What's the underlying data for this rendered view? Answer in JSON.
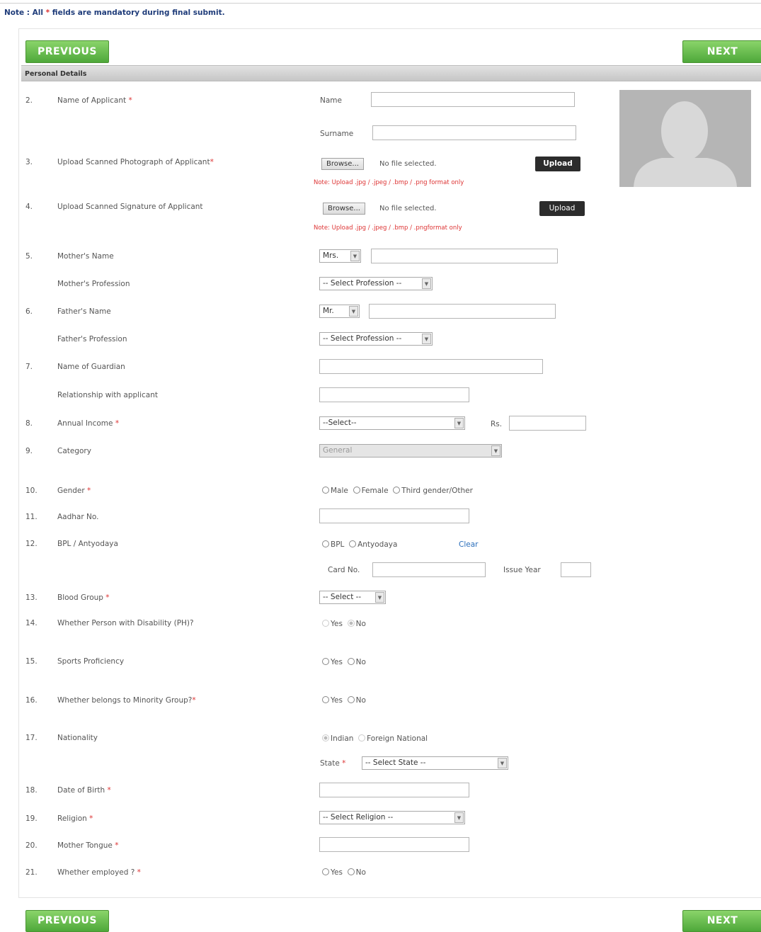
{
  "note": {
    "prefix": "Note : All",
    "star": "*",
    "suffix": "fields are mandatory during final submit."
  },
  "buttons": {
    "previous": "PREVIOUS",
    "next": "NEXT"
  },
  "section_title": "Personal Details",
  "q2": {
    "num": "2.",
    "label": "Name of Applicant",
    "star": "*",
    "name_label": "Name",
    "surname_label": "Surname"
  },
  "q3": {
    "num": "3.",
    "label": "Upload Scanned Photograph of Applicant",
    "star": "*",
    "browse": "Browse...",
    "file_status": "No file selected.",
    "upload": "Upload",
    "note": "Note: Upload .jpg / .jpeg / .bmp / .png format only"
  },
  "q4": {
    "num": "4.",
    "label": "Upload Scanned Signature of Applicant",
    "browse": "Browse...",
    "file_status": "No file selected.",
    "upload": "Upload",
    "note": "Note: Upload .jpg / .jpeg / .bmp / .pngformat only"
  },
  "q5": {
    "num": "5.",
    "label": "Mother's Name",
    "title": "Mrs.",
    "profession_label": "Mother's Profession",
    "profession": "-- Select Profession --"
  },
  "q6": {
    "num": "6.",
    "label": "Father's Name",
    "title": "Mr.",
    "profession_label": "Father's Profession",
    "profession": "-- Select Profession --"
  },
  "q7": {
    "num": "7.",
    "label": "Name of Guardian",
    "relationship_label": "Relationship with applicant"
  },
  "q8": {
    "num": "8.",
    "label": "Annual Income",
    "star": "*",
    "select": "--Select--",
    "rs": "Rs."
  },
  "q9": {
    "num": "9.",
    "label": "Category",
    "value": "General"
  },
  "q10": {
    "num": "10.",
    "label": "Gender",
    "star": "*",
    "options": [
      "Male",
      "Female",
      "Third gender/Other"
    ]
  },
  "q11": {
    "num": "11.",
    "label": "Aadhar No."
  },
  "q12": {
    "num": "12.",
    "label": "BPL / Antyodaya",
    "options": [
      "BPL",
      "Antyodaya"
    ],
    "clear": "Clear",
    "card_label": "Card No.",
    "issue_label": "Issue Year"
  },
  "q13": {
    "num": "13.",
    "label": "Blood Group",
    "star": "*",
    "select": "-- Select --"
  },
  "q14": {
    "num": "14.",
    "label": "Whether Person with Disability (PH)?",
    "options": [
      "Yes",
      "No"
    ]
  },
  "q15": {
    "num": "15.",
    "label": "Sports Proficiency",
    "options": [
      "Yes",
      "No"
    ]
  },
  "q16": {
    "num": "16.",
    "label": "Whether belongs to Minority Group?",
    "star": "*",
    "options": [
      "Yes",
      "No"
    ]
  },
  "q17": {
    "num": "17.",
    "label": "Nationality",
    "options": [
      "Indian",
      "Foreign National"
    ],
    "state_label": "State",
    "star": "*",
    "state": "-- Select State --"
  },
  "q18": {
    "num": "18.",
    "label": "Date of Birth",
    "star": "*"
  },
  "q19": {
    "num": "19.",
    "label": "Religion",
    "star": "*",
    "select": "-- Select Religion --"
  },
  "q20": {
    "num": "20.",
    "label": "Mother Tongue",
    "star": "*"
  },
  "q21": {
    "num": "21.",
    "label": "Whether employed ?",
    "star": "*",
    "options": [
      "Yes",
      "No"
    ]
  }
}
